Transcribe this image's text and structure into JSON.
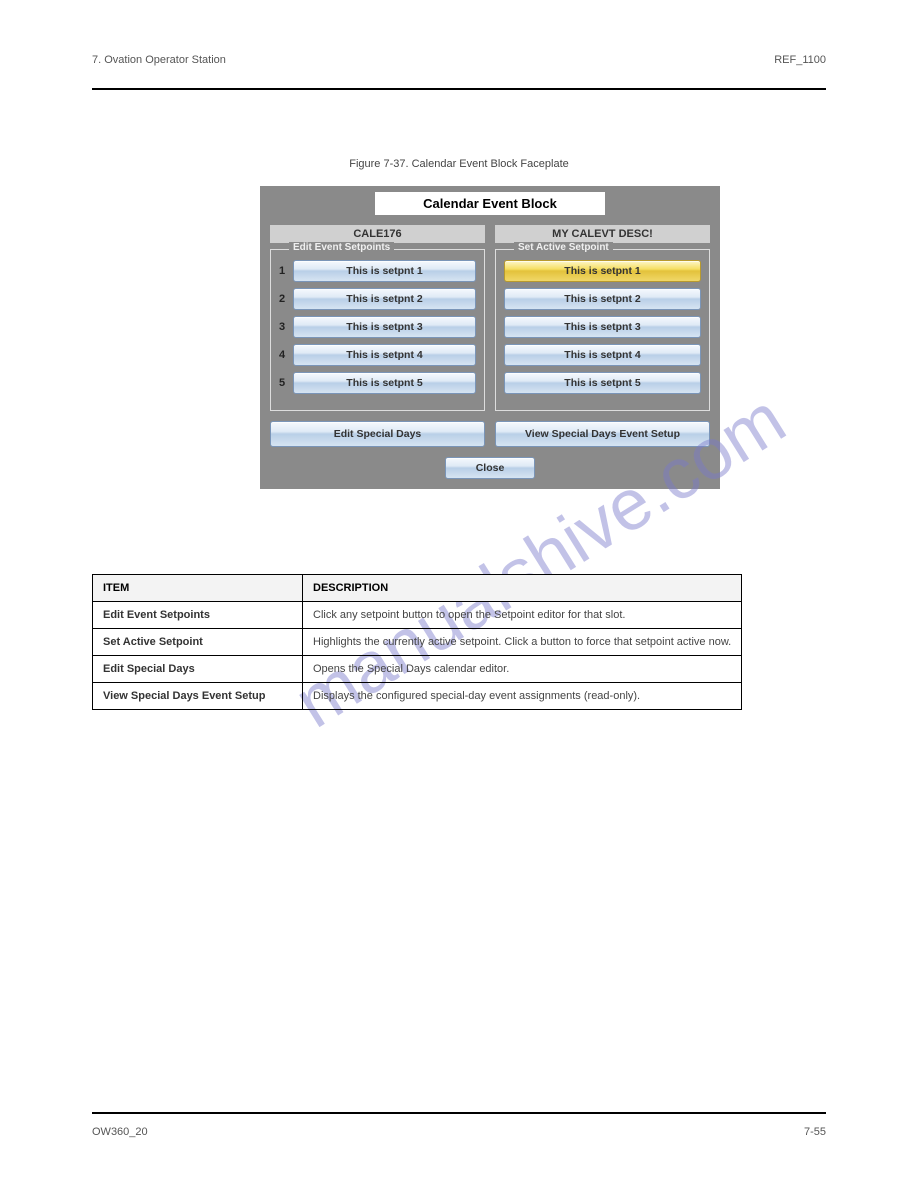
{
  "header": {
    "left": "7. Ovation Operator Station",
    "right": "REF_1100"
  },
  "figure_label": "Figure 7-37. Calendar Event Block Faceplate",
  "dialog": {
    "title": "Calendar Event Block",
    "left_label": "CALE176",
    "right_label": "MY CALEVT DESC!",
    "edit_legend": "Edit Event Setpoints",
    "active_legend": "Set Active Setpoint",
    "setpoints": [
      "This is setpnt 1",
      "This is setpnt 2",
      "This is setpnt 3",
      "This is setpnt 4",
      "This is setpnt 5"
    ],
    "nums": [
      "1",
      "2",
      "3",
      "4",
      "5"
    ],
    "edit_special": "Edit Special Days",
    "view_special": "View Special Days Event Setup",
    "close": "Close"
  },
  "table": {
    "head_name": "ITEM",
    "head_desc": "DESCRIPTION",
    "rows": [
      {
        "name": "Edit Event Setpoints",
        "desc": "Click any setpoint button to open the Setpoint editor for that slot."
      },
      {
        "name": "Set Active Setpoint",
        "desc": "Highlights the currently active setpoint. Click a button to force that setpoint active now."
      },
      {
        "name": "Edit Special Days",
        "desc": "Opens the Special Days calendar editor."
      },
      {
        "name": "View Special Days Event Setup",
        "desc": "Displays the configured special-day event assignments (read-only)."
      }
    ]
  },
  "watermark": "manualshive.com",
  "footer": {
    "left": "OW360_20",
    "right": "7-55"
  }
}
